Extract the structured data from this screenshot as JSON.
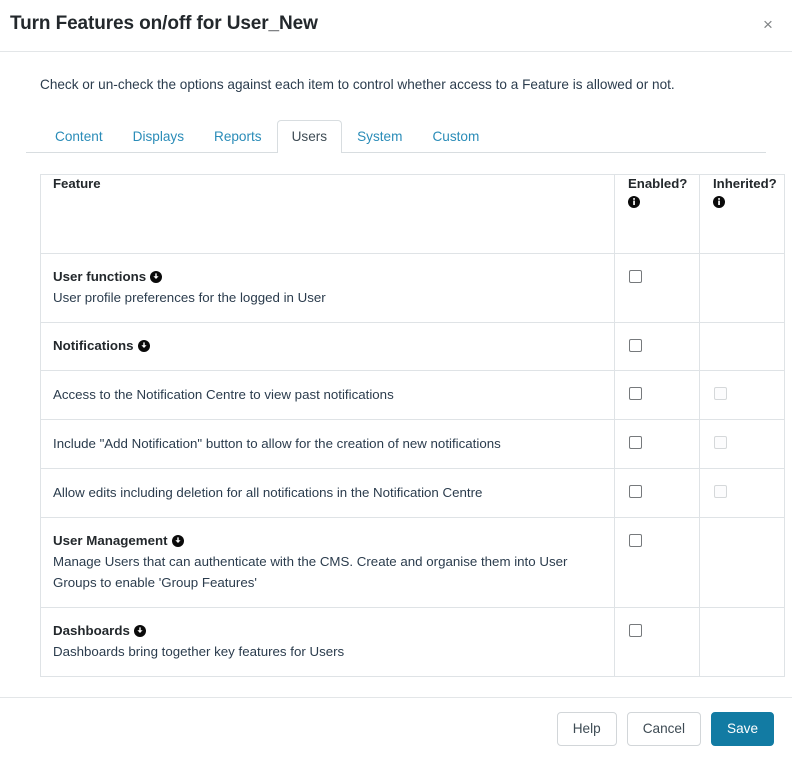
{
  "modal": {
    "title": "Turn Features on/off for User_New",
    "close_label": "×",
    "intro": "Check or un-check the options against each item to control whether access to a Feature is allowed or not."
  },
  "tabs": [
    {
      "label": "Content",
      "active": false
    },
    {
      "label": "Displays",
      "active": false
    },
    {
      "label": "Reports",
      "active": false
    },
    {
      "label": "Users",
      "active": true
    },
    {
      "label": "System",
      "active": false
    },
    {
      "label": "Custom",
      "active": false
    }
  ],
  "table": {
    "headers": {
      "feature": "Feature",
      "enabled": "Enabled?",
      "inherited": "Inherited?"
    },
    "rows": [
      {
        "title": "User functions",
        "has_expand_icon": true,
        "description": "User profile preferences for the logged in User",
        "enabled_checkbox": true,
        "enabled_checked": false,
        "inherited_checkbox": false,
        "inherited_checked": false
      },
      {
        "title": "Notifications",
        "has_expand_icon": true,
        "description": "",
        "enabled_checkbox": true,
        "enabled_checked": false,
        "inherited_checkbox": false,
        "inherited_checked": false
      },
      {
        "title": "",
        "has_expand_icon": false,
        "description": "Access to the Notification Centre to view past notifications",
        "enabled_checkbox": true,
        "enabled_checked": false,
        "inherited_checkbox": true,
        "inherited_checked": false
      },
      {
        "title": "",
        "has_expand_icon": false,
        "description": "Include \"Add Notification\" button to allow for the creation of new notifications",
        "enabled_checkbox": true,
        "enabled_checked": false,
        "inherited_checkbox": true,
        "inherited_checked": false
      },
      {
        "title": "",
        "has_expand_icon": false,
        "description": "Allow edits including deletion for all notifications in the Notification Centre",
        "enabled_checkbox": true,
        "enabled_checked": false,
        "inherited_checkbox": true,
        "inherited_checked": false
      },
      {
        "title": "User Management",
        "has_expand_icon": true,
        "description": "Manage Users that can authenticate with the CMS. Create and organise them into User Groups to enable 'Group Features'",
        "enabled_checkbox": true,
        "enabled_checked": false,
        "inherited_checkbox": false,
        "inherited_checked": false
      },
      {
        "title": "Dashboards",
        "has_expand_icon": true,
        "description": "Dashboards bring together key features for Users",
        "enabled_checkbox": true,
        "enabled_checked": false,
        "inherited_checkbox": false,
        "inherited_checked": false
      }
    ]
  },
  "footer": {
    "help_label": "Help",
    "cancel_label": "Cancel",
    "save_label": "Save"
  },
  "colors": {
    "primary": "#127ba3",
    "link": "#2a8cb8",
    "text": "#2b3c4d",
    "heading": "#23282c",
    "border": "#dfe3e6"
  }
}
